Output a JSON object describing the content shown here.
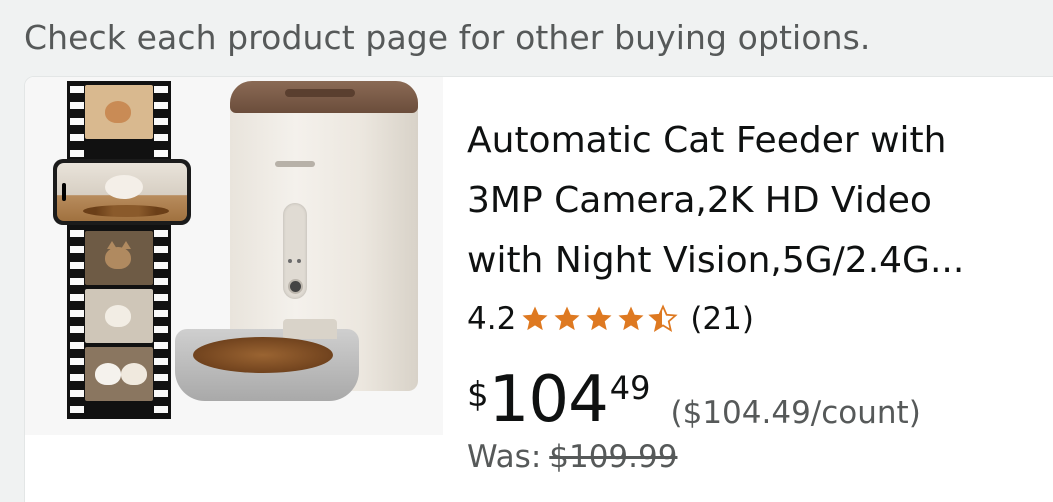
{
  "note": "Check each product page for other buying options.",
  "product": {
    "title_lines": [
      "Automatic Cat Feeder with",
      "3MP Camera,2K HD Video",
      "with Night Vision,5G/2.4G..."
    ],
    "rating": "4.2",
    "rating_value": 4.2,
    "rating_max": 5,
    "review_count": "(21)",
    "price": {
      "currency": "$",
      "whole": "104",
      "fraction": "49",
      "unit_price": "($104.49/count)"
    },
    "was_label": "Was:",
    "was_price": "$109.99"
  },
  "colors": {
    "star": "#de7921",
    "text": "#0f1111",
    "muted": "#565959"
  },
  "icons": [
    "star-full-icon",
    "star-half-icon"
  ]
}
